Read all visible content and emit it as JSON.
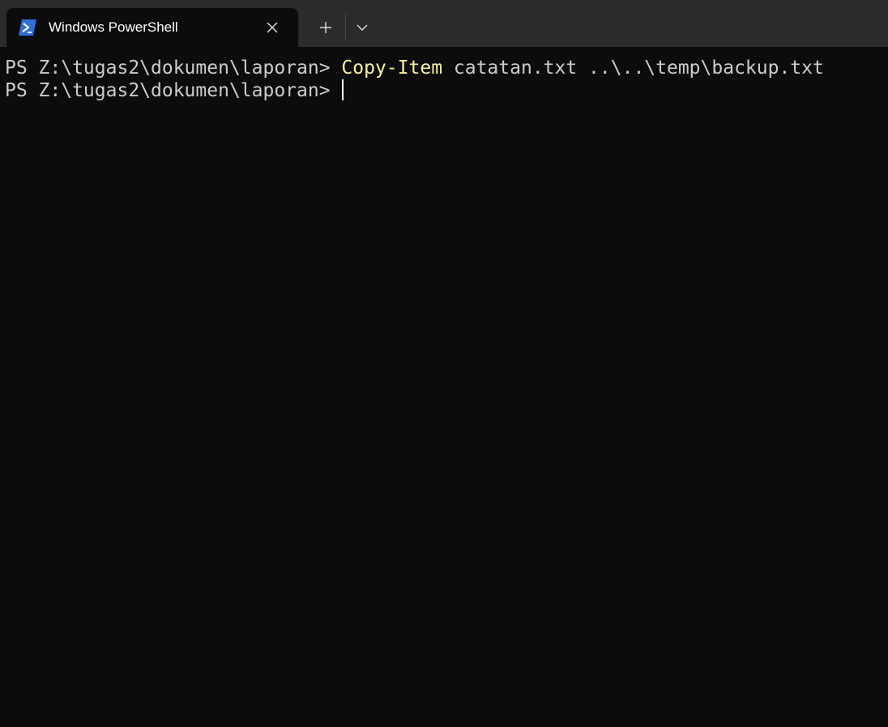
{
  "tab": {
    "title": "Windows PowerShell",
    "icon": "powershell-icon",
    "close_icon": "close-icon"
  },
  "toolbar": {
    "new_tab_icon": "plus-icon",
    "dropdown_icon": "chevron-down-icon"
  },
  "terminal": {
    "lines": [
      {
        "prompt": "PS Z:\\tugas2\\dokumen\\laporan> ",
        "command": "Copy-Item",
        "args": " catatan.txt ..\\..\\temp\\backup.txt"
      },
      {
        "prompt": "PS Z:\\tugas2\\dokumen\\laporan> ",
        "command": "",
        "args": ""
      }
    ]
  },
  "colors": {
    "background": "#0c0c0c",
    "titlebar": "#2b2b2b",
    "text": "#cccccc",
    "command": "#f9f1a5",
    "icon_blue": "#2f6fd6"
  }
}
